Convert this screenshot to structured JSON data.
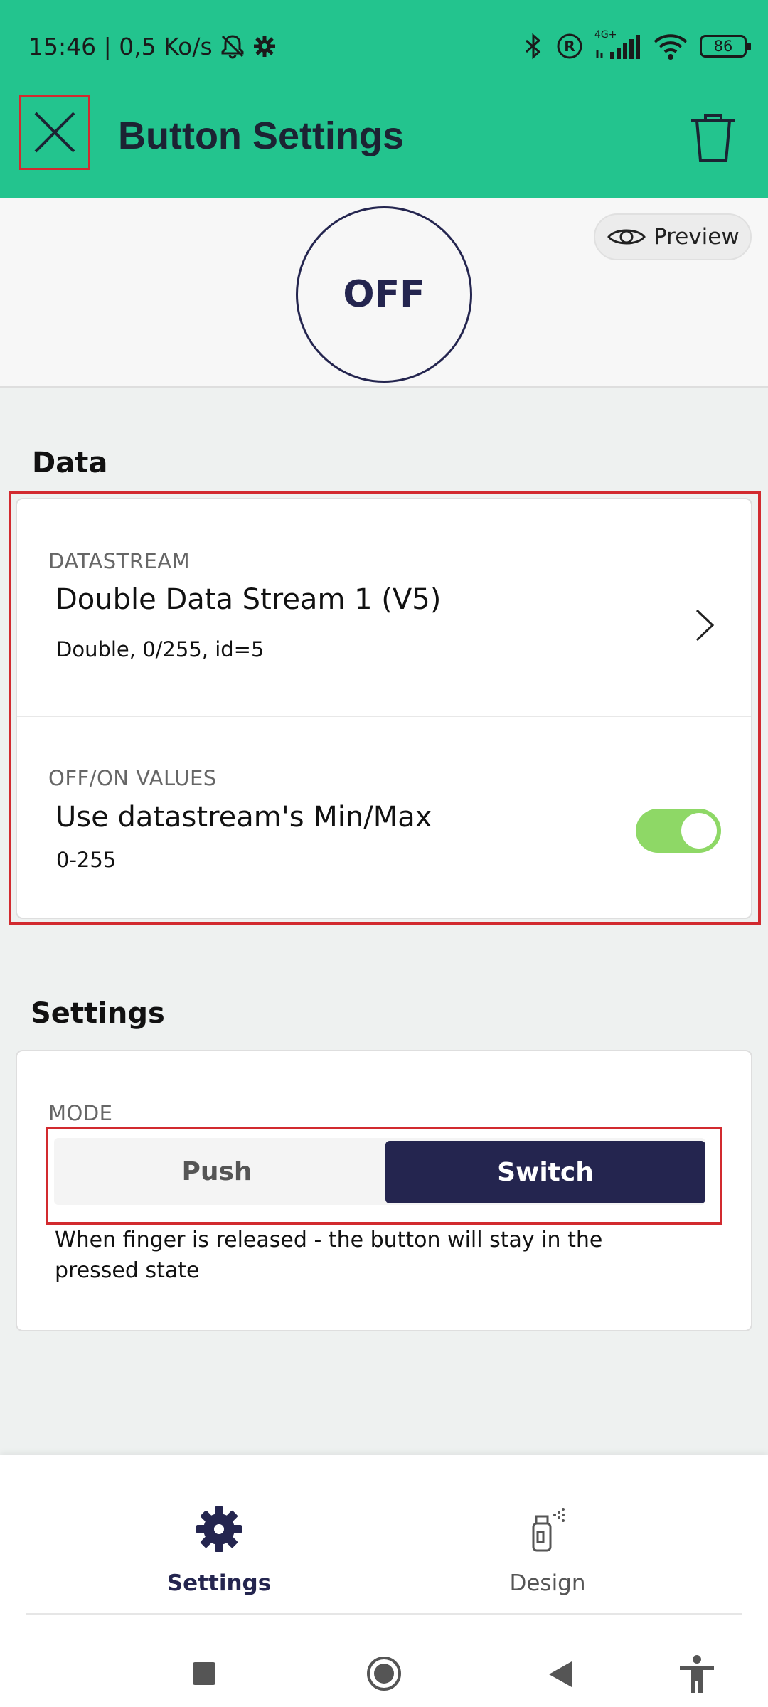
{
  "status_bar": {
    "time_and_speed": "15:46 | 0,5 Ko/s",
    "network_label": "4G+",
    "battery": "86"
  },
  "toolbar": {
    "title": "Button Settings"
  },
  "preview": {
    "button_state": "OFF",
    "preview_label": "Preview"
  },
  "data_section": {
    "title": "Data",
    "datastream": {
      "label": "DATASTREAM",
      "name": "Double Data Stream 1 (V5)",
      "details": "Double, 0/255, id=5"
    },
    "values": {
      "label": "OFF/ON VALUES",
      "name": "Use datastream's Min/Max",
      "range": "0-255",
      "toggle_on": true
    }
  },
  "settings_section": {
    "title": "Settings",
    "mode_label": "MODE",
    "options": [
      "Push",
      "Switch"
    ],
    "selected": "Switch",
    "description": "When finger is released - the button will stay in the pressed state"
  },
  "bottom_nav": {
    "tabs": [
      {
        "label": "Settings",
        "active": true
      },
      {
        "label": "Design",
        "active": false
      }
    ]
  },
  "colors": {
    "brand": "#23c48e",
    "accent_dark": "#24254f",
    "highlight": "#d22a2f",
    "toggle_on": "#8ed866"
  }
}
